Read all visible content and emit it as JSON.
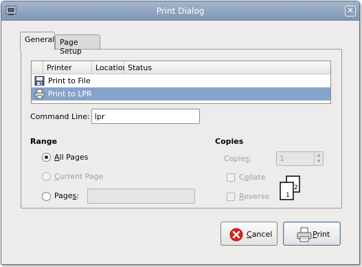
{
  "window": {
    "title": "Print Dialog"
  },
  "tabs": [
    {
      "label": "General",
      "active": true
    },
    {
      "label": "Page Setup",
      "active": false
    }
  ],
  "printer_list": {
    "columns": [
      "Printer",
      "Location",
      "Status"
    ],
    "rows": [
      {
        "icon": "floppy-disk-icon",
        "printer": "Print to File",
        "selected": false
      },
      {
        "icon": "printer-icon",
        "printer": "Print to LPR",
        "selected": true
      }
    ]
  },
  "command_line": {
    "label": "Command Line:",
    "value": "lpr"
  },
  "range": {
    "title": "Range",
    "all_pages": {
      "label": "All Pages",
      "mnemonic": "A",
      "rest": "ll Pages",
      "checked": true
    },
    "current_page": {
      "mnemonic": "C",
      "rest": "urrent Page",
      "disabled": true
    },
    "pages": {
      "before": "Page",
      "mnemonic": "s",
      "after": ":",
      "value": ""
    }
  },
  "copies": {
    "title": "Copies",
    "label_before": "Copie",
    "mnemonic": "s",
    "label_after": ":",
    "value": "1",
    "collate": {
      "before": "C",
      "mnemonic": "o",
      "after": "llate",
      "disabled": true
    },
    "reverse": {
      "mnemonic": "R",
      "rest": "everse",
      "disabled": true
    },
    "collate_icon_numbers": [
      "1",
      "2"
    ]
  },
  "buttons": {
    "cancel": {
      "mnemonic": "C",
      "rest": "ancel",
      "icon": "cancel-icon"
    },
    "print": {
      "mnemonic": "P",
      "rest": "rint",
      "icon": "printer-icon"
    }
  },
  "colors": {
    "titlebar": "#8ea4c0",
    "selection": "#86a3cc",
    "window_bg": "#edeceb",
    "cancel_red": "#d8231f"
  }
}
